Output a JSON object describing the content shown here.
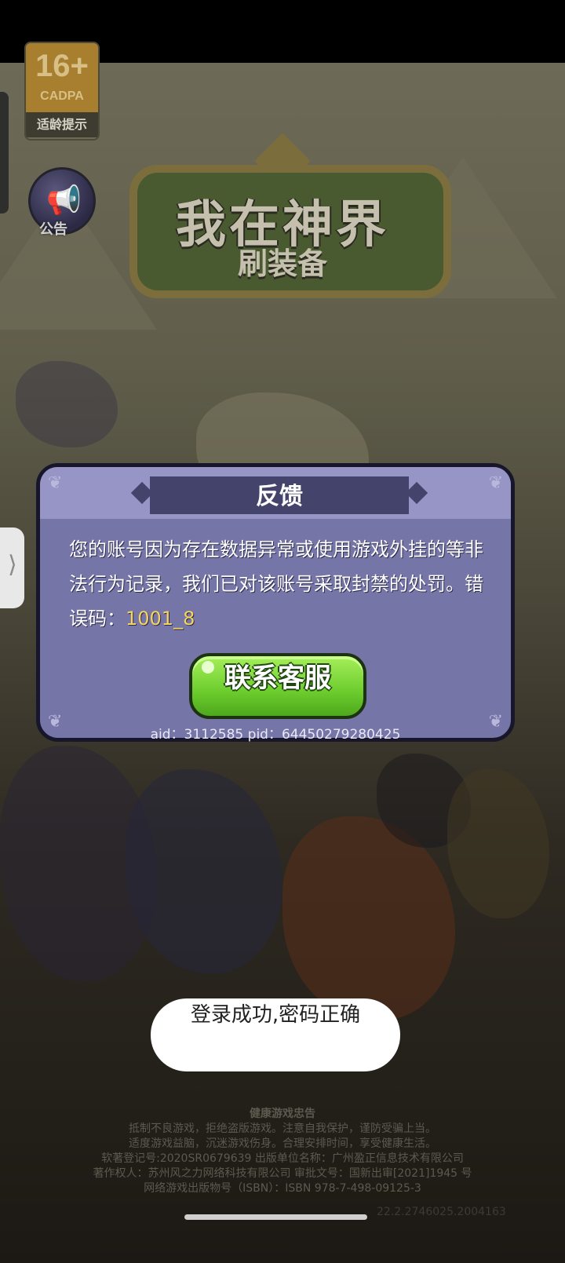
{
  "age_rating": {
    "age": "16+",
    "org": "CADPA",
    "tip": "适龄提示"
  },
  "notice": {
    "label": "公告"
  },
  "logo": {
    "title": "我在神界",
    "subtitle": "刷装备"
  },
  "dialog": {
    "title": "反馈",
    "message": "您的账号因为存在数据异常或使用游戏外挂的等非法行为记录，我们已对该账号采取封禁的处罚。错误码：",
    "error_code": "1001_8",
    "button": "联系客服",
    "ids": "aid：3112585  pid：64450279280425"
  },
  "toast": {
    "text": "登录成功,密码正确"
  },
  "footer": {
    "heading": "健康游戏忠告",
    "line1": "抵制不良游戏，拒绝盗版游戏。注意自我保护，谨防受骗上当。",
    "line2": "适度游戏益脑，沉迷游戏伤身。合理安排时间，享受健康生活。",
    "line3": "软著登记号:2020SR0679639 出版单位名称：广州盈正信息技术有限公司",
    "line4": "著作权人：苏州风之力网络科技有限公司 审批文号：国新出审[2021]1945 号",
    "line5": "网络游戏出版物号（ISBN）：ISBN 978-7-498-09125-3"
  },
  "build_code": "22.2.2746025.2004163"
}
